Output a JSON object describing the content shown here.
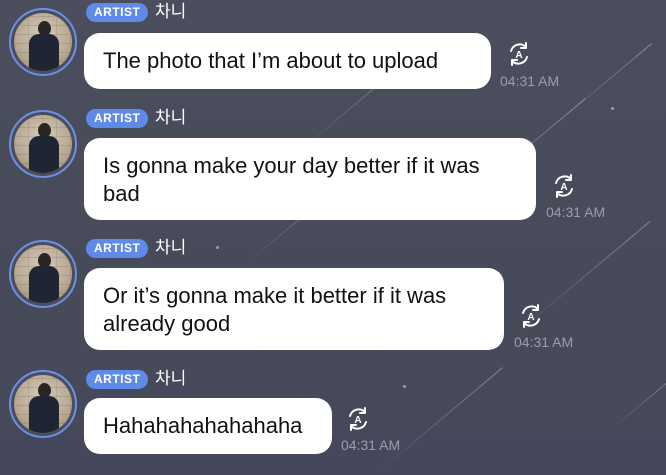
{
  "messages": [
    {
      "badge": "ARTIST",
      "name": "차니",
      "text": "The photo that I’m about to upload",
      "time": "04:31 AM"
    },
    {
      "badge": "ARTIST",
      "name": "차니",
      "text": "Is gonna make your day better if it was bad",
      "time": "04:31 AM"
    },
    {
      "badge": "ARTIST",
      "name": "차니",
      "text": "Or it’s gonna make it better if it was already good",
      "time": "04:31 AM"
    },
    {
      "badge": "ARTIST",
      "name": "차니",
      "text": "Hahahahahahahaha",
      "time": "04:31 AM"
    }
  ],
  "icons": {
    "avatar": "artist-avatar",
    "translate": "translate-icon"
  },
  "colors": {
    "background": "#4a4e5c",
    "badge": "#5f8ae8",
    "avatar_ring": "#6e8fe6",
    "bubble": "#ffffff",
    "timestamp": "#9a9eaa"
  }
}
